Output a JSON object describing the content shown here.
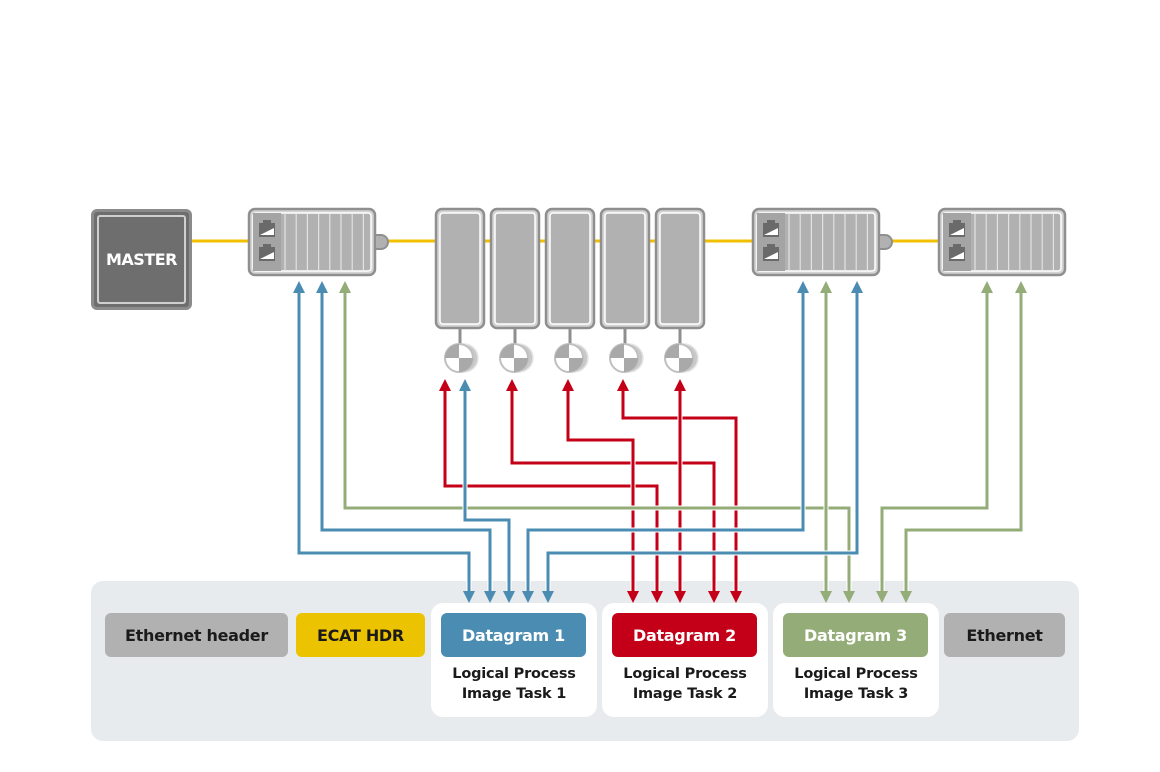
{
  "master": {
    "label": "MASTER"
  },
  "frame": {
    "segments": [
      {
        "label": "Ethernet header",
        "color": "#b1b1b1",
        "text_color": "#1a1a1a"
      },
      {
        "label": "ECAT HDR",
        "color": "#ecc300",
        "text_color": "#1a1a1a"
      },
      {
        "label": "Datagram 1",
        "color": "#4b8db2",
        "text_color": "#ffffff"
      },
      {
        "label": "Datagram 2",
        "color": "#c30017",
        "text_color": "#ffffff"
      },
      {
        "label": "Datagram 3",
        "color": "#94ad78",
        "text_color": "#ffffff"
      },
      {
        "label": "Ethernet",
        "color": "#b1b1b1",
        "text_color": "#1a1a1a"
      }
    ],
    "tasks": [
      {
        "line1": "Logical Process",
        "line2": "Image Task 1"
      },
      {
        "line1": "Logical Process",
        "line2": "Image Task 2"
      },
      {
        "line1": "Logical Process",
        "line2": "Image Task 3"
      }
    ]
  },
  "colors": {
    "bus": "#f0c000",
    "task1": "#4b8db2",
    "task2": "#c30017",
    "task3": "#94ad78",
    "device": "#b1b1b1",
    "device_border": "#8f8f8f",
    "frame_bg": "#e8ebee"
  },
  "devices": [
    {
      "name": "io-terminal-1",
      "type": "io-module"
    },
    {
      "name": "servo-drive-1",
      "type": "drive"
    },
    {
      "name": "servo-drive-2",
      "type": "drive"
    },
    {
      "name": "servo-drive-3",
      "type": "drive"
    },
    {
      "name": "servo-drive-4",
      "type": "drive"
    },
    {
      "name": "servo-drive-5",
      "type": "drive"
    },
    {
      "name": "io-terminal-2",
      "type": "io-module"
    },
    {
      "name": "io-terminal-3",
      "type": "io-module"
    }
  ],
  "connections": [
    {
      "task": "task1",
      "from": "io-terminal-1",
      "to": "Datagram 1"
    },
    {
      "task": "task1",
      "from": "io-terminal-1",
      "to": "Datagram 1"
    },
    {
      "task": "task3",
      "from": "io-terminal-1",
      "to": "Datagram 3"
    },
    {
      "task": "task1",
      "from": "servo-drive-1",
      "to": "Datagram 1"
    },
    {
      "task": "task2",
      "from": "servo-drive-1",
      "to": "Datagram 2"
    },
    {
      "task": "task2",
      "from": "servo-drive-2",
      "to": "Datagram 2"
    },
    {
      "task": "task2",
      "from": "servo-drive-3",
      "to": "Datagram 2"
    },
    {
      "task": "task2",
      "from": "servo-drive-4",
      "to": "Datagram 2"
    },
    {
      "task": "task2",
      "from": "servo-drive-5",
      "to": "Datagram 2"
    },
    {
      "task": "task1",
      "from": "io-terminal-2",
      "to": "Datagram 1"
    },
    {
      "task": "task3",
      "from": "io-terminal-2",
      "to": "Datagram 3"
    },
    {
      "task": "task1",
      "from": "io-terminal-2",
      "to": "Datagram 1"
    },
    {
      "task": "task3",
      "from": "io-terminal-3",
      "to": "Datagram 3"
    },
    {
      "task": "task3",
      "from": "io-terminal-3",
      "to": "Datagram 3"
    }
  ]
}
